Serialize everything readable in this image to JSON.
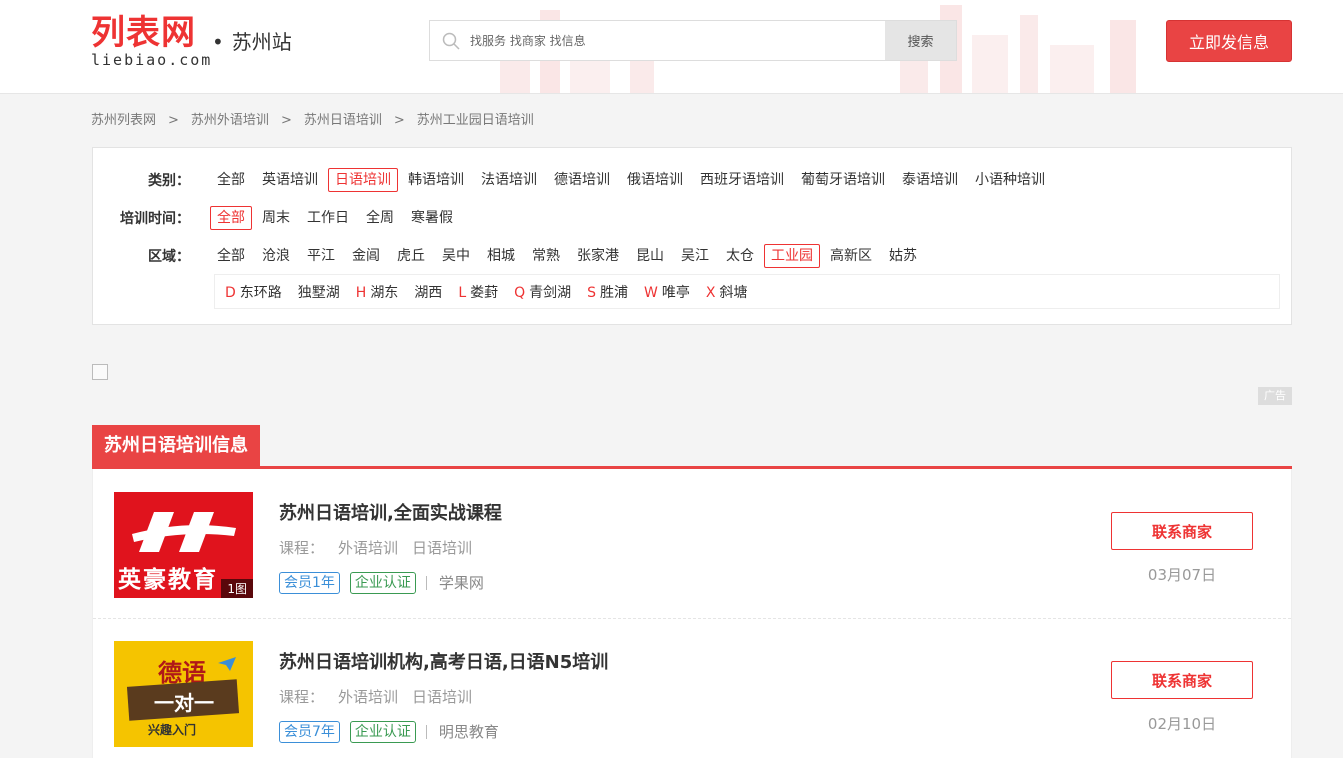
{
  "header": {
    "logo_main": "列表网",
    "logo_sub": "liebiao.com",
    "city_dot": "•",
    "city": "苏州站",
    "search_placeholder": "找服务 找商家 找信息",
    "search_button": "搜索",
    "post_button": "立即发信息"
  },
  "breadcrumb": [
    {
      "label": "苏州列表网"
    },
    {
      "label": "苏州外语培训"
    },
    {
      "label": "苏州日语培训"
    },
    {
      "label": "苏州工业园日语培训"
    }
  ],
  "breadcrumb_sep": ">",
  "filters": {
    "category": {
      "label": "类别：",
      "options": [
        "全部",
        "英语培训",
        "日语培训",
        "韩语培训",
        "法语培训",
        "德语培训",
        "俄语培训",
        "西班牙语培训",
        "葡萄牙语培训",
        "泰语培训",
        "小语种培训"
      ],
      "active": "日语培训"
    },
    "time": {
      "label": "培训时间：",
      "options": [
        "全部",
        "周末",
        "工作日",
        "全周",
        "寒暑假"
      ],
      "active": "全部"
    },
    "region": {
      "label": "区域：",
      "options": [
        "全部",
        "沧浪",
        "平江",
        "金阊",
        "虎丘",
        "吴中",
        "相城",
        "常熟",
        "张家港",
        "昆山",
        "吴江",
        "太仓",
        "工业园",
        "高新区",
        "姑苏"
      ],
      "active": "工业园"
    },
    "subregions": [
      {
        "letter": "D",
        "name": "东环路"
      },
      {
        "letter": "",
        "name": "独墅湖"
      },
      {
        "letter": "H",
        "name": "湖东"
      },
      {
        "letter": "",
        "name": "湖西"
      },
      {
        "letter": "L",
        "name": "娄葑"
      },
      {
        "letter": "Q",
        "name": "青剑湖"
      },
      {
        "letter": "S",
        "name": "胜浦"
      },
      {
        "letter": "W",
        "name": "唯亭"
      },
      {
        "letter": "X",
        "name": "斜塘"
      }
    ]
  },
  "ad": {
    "tag": "广告"
  },
  "section": {
    "title": "苏州日语培训信息"
  },
  "listings": [
    {
      "title": "苏州日语培训,全面实战课程",
      "course_label": "课程：",
      "course_tags": [
        "外语培训",
        "日语培训"
      ],
      "member": "会员1年",
      "cert": "企业认证",
      "company": "学果网",
      "contact": "联系商家",
      "date": "03月07日",
      "thumb_text": "英豪教育",
      "thumb_count": "1图"
    },
    {
      "title": "苏州日语培训机构,高考日语,日语N5培训",
      "course_label": "课程：",
      "course_tags": [
        "外语培训",
        "日语培训"
      ],
      "member": "会员7年",
      "cert": "企业认证",
      "company": "明思教育",
      "contact": "联系商家",
      "date": "02月10日",
      "thumb_text": "德语",
      "thumb_sub": "一对一",
      "thumb_sub2": "兴趣入门"
    }
  ],
  "colors": {
    "accent": "#e94444",
    "member": "#3b8fd8",
    "cert": "#3a9a52"
  }
}
